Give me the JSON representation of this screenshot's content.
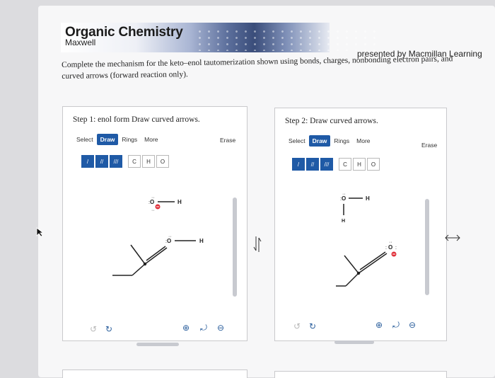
{
  "header": {
    "title": "Organic Chemistry",
    "subtitle": "Maxwell",
    "presented_by": "presented by Macmillan Learning",
    "instructions": "Complete the mechanism for the keto–enol tautomerization shown using bonds, charges, nonbonding electron pairs, and curved arrows (forward reaction only)."
  },
  "step1": {
    "title": "Step 1: enol form Draw curved arrows.",
    "toolbar": [
      "Select",
      "Draw",
      "Rings",
      "More"
    ],
    "active_tab": "Draw",
    "erase": "Erase",
    "tools": [
      "/",
      "//",
      "///",
      "C",
      "H",
      "O"
    ],
    "molecule": {
      "o": "O",
      "h": "H"
    },
    "hydroxide": {
      "o": "O",
      "h": "H"
    }
  },
  "step2": {
    "title": "Step 2: Draw curved arrows.",
    "toolbar": [
      "Select",
      "Draw",
      "Rings",
      "More"
    ],
    "active_tab": "Draw",
    "erase": "Erase",
    "tools": [
      "/",
      "//",
      "///",
      "C",
      "H",
      "O"
    ],
    "water": {
      "o": "O",
      "h1": "H",
      "h2": "H"
    },
    "molecule": {
      "o": "O"
    }
  },
  "colors": {
    "accent": "#1f5aa6",
    "negative_charge": "#e0303a"
  }
}
